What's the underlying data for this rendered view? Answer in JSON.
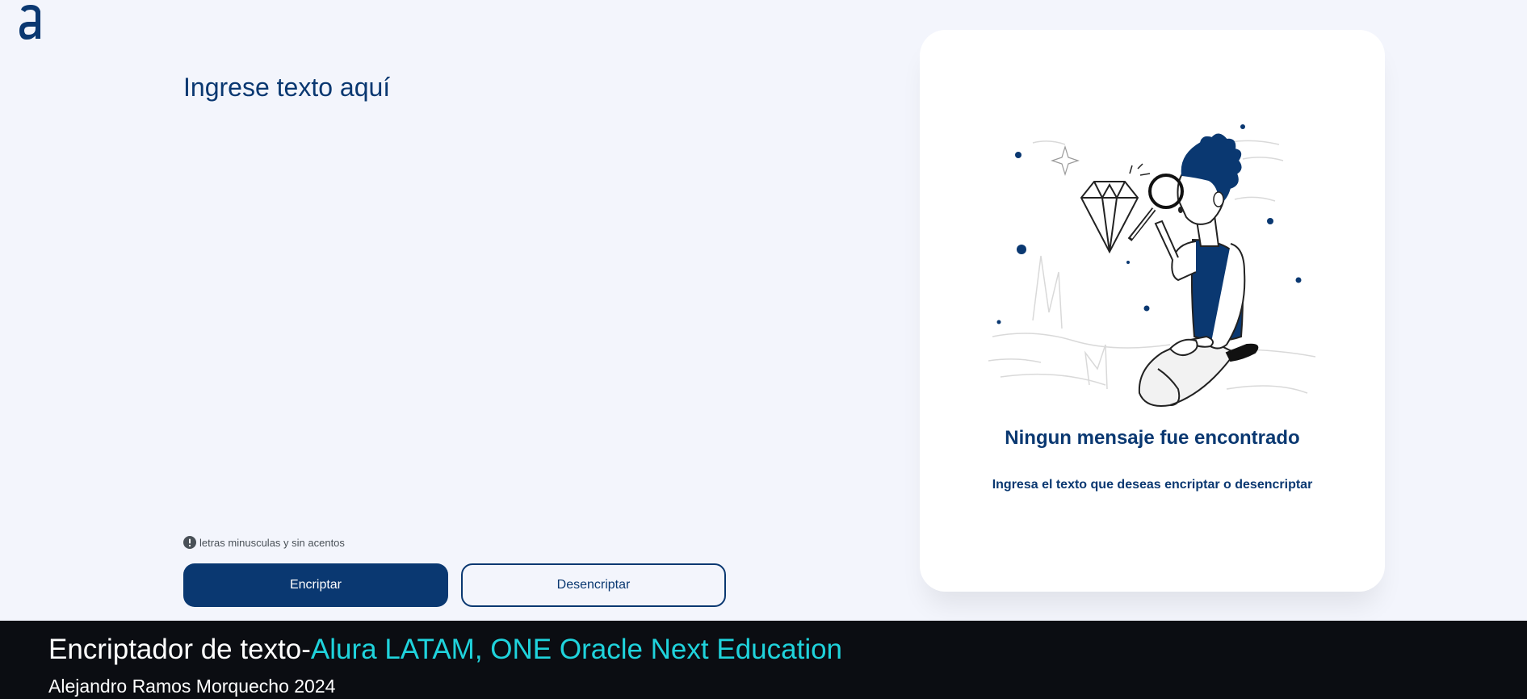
{
  "input": {
    "placeholder": "Ingrese texto aquí",
    "value": ""
  },
  "hint": {
    "text": "letras minusculas y sin acentos",
    "icon": "exclamation-circle-icon"
  },
  "buttons": {
    "encrypt_label": "Encriptar",
    "decrypt_label": "Desencriptar"
  },
  "output_card": {
    "title": "Ningun mensaje fue encontrado",
    "subtitle": "Ingresa el texto que deseas encriptar o desencriptar",
    "illustration": "person-with-magnifying-glass-and-diamond"
  },
  "footer": {
    "title_main": "Encriptador de texto-",
    "title_accent": "Alura LATAM, ONE Oracle Next Education",
    "credit": "Alejandro Ramos Morquecho 2024"
  },
  "colors": {
    "primary": "#0a3871",
    "background": "#f3f5fc",
    "footer_bg": "#0b0d12",
    "footer_accent": "#1fd3dc"
  }
}
